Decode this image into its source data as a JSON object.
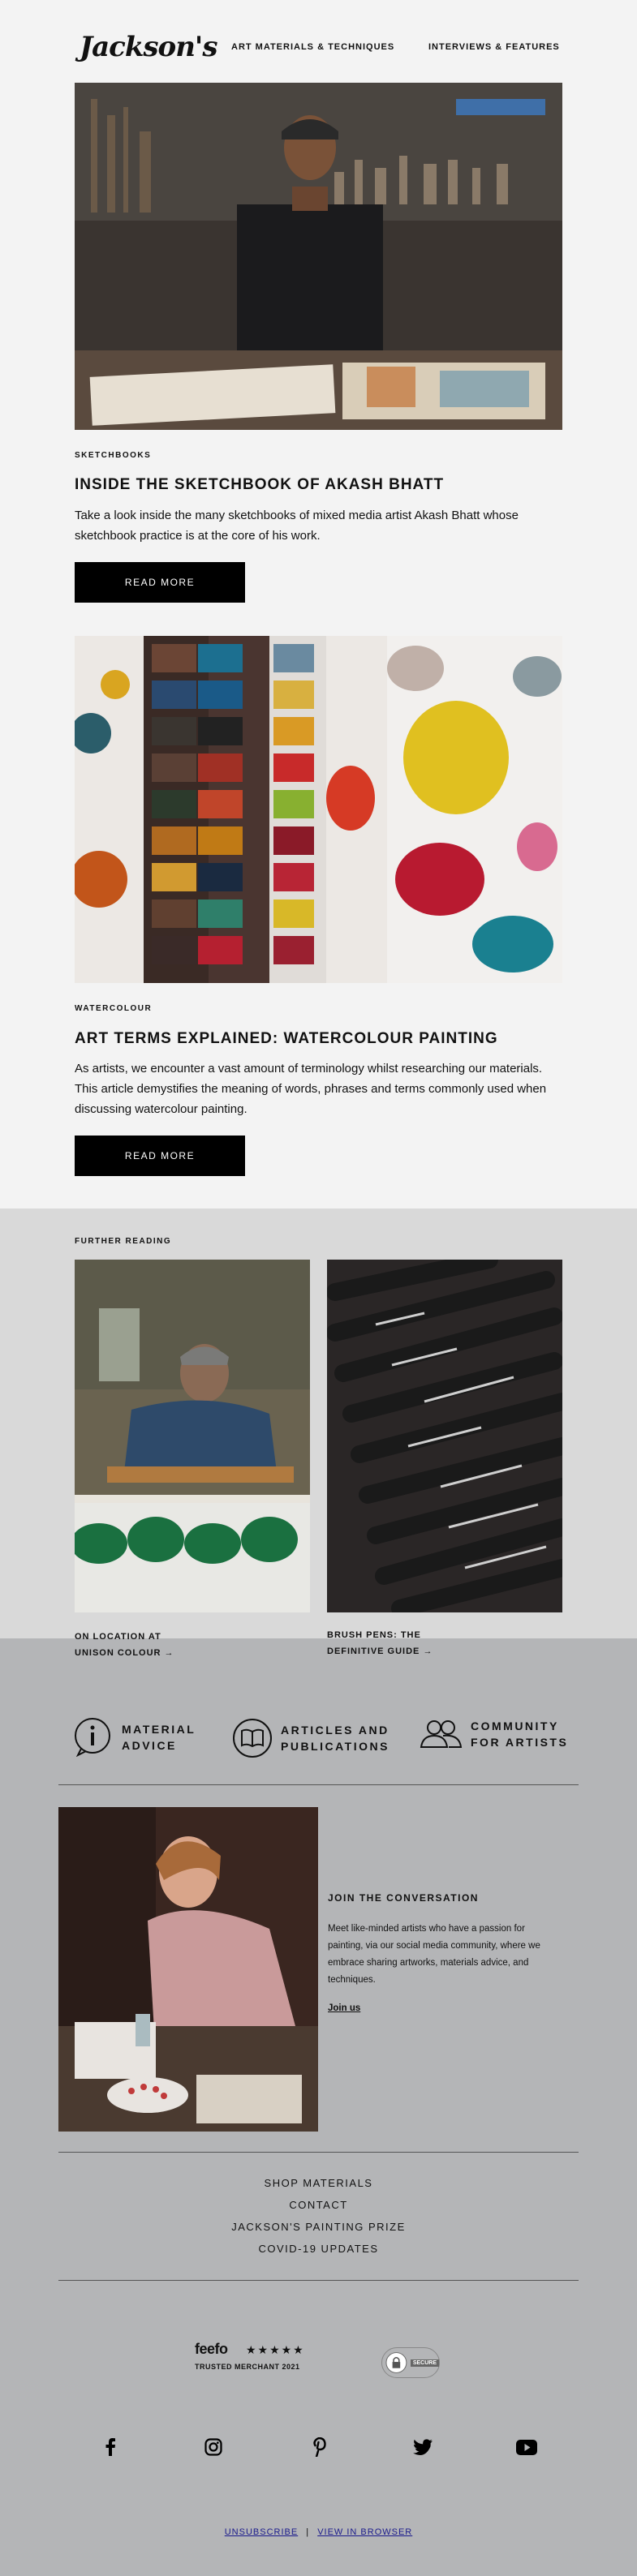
{
  "header": {
    "logo": "Jackson's",
    "nav": [
      "ART MATERIALS & TECHNIQUES",
      "INTERVIEWS & FEATURES"
    ]
  },
  "articles": [
    {
      "tag": "SKETCHBOOKS",
      "title": "INSIDE THE SKETCHBOOK OF AKASH BHATT",
      "body": "Take a look inside the many sketchbooks of mixed media artist Akash Bhatt whose sketchbook practice is at the core of his work.",
      "cta": "READ MORE"
    },
    {
      "tag": "WATERCOLOUR",
      "title": "ART TERMS EXPLAINED: WATERCOLOUR PAINTING",
      "body": "As artists, we encounter a vast amount of terminology whilst researching our materials. This article demystifies the meaning of words, phrases and terms commonly used when discussing watercolour painting.",
      "cta": "READ MORE"
    }
  ],
  "further": {
    "heading": "FURTHER READING",
    "items": [
      {
        "line1": "ON LOCATION AT",
        "line2": "UNISON COLOUR →"
      },
      {
        "line1": "BRUSH PENS: THE",
        "line2": "DEFINITIVE GUIDE →"
      }
    ]
  },
  "features": [
    {
      "icon": "info-icon",
      "line1": "MATERIAL",
      "line2": "ADVICE"
    },
    {
      "icon": "book-icon",
      "line1": "ARTICLES AND",
      "line2": "PUBLICATIONS"
    },
    {
      "icon": "people-icon",
      "line1": "COMMUNITY",
      "line2": "FOR ARTISTS"
    }
  ],
  "community": {
    "heading": "JOIN THE CONVERSATION",
    "body": "Meet like-minded artists who have a passion for painting, via our social media community, where we embrace sharing artworks, materials advice, and techniques.",
    "link": "Join us"
  },
  "footer_links": [
    "SHOP MATERIALS",
    "CONTACT",
    "JACKSON'S PAINTING PRIZE",
    "COVID-19 UPDATES"
  ],
  "badges": {
    "feefo": "feefo",
    "stars": "★★★★★",
    "trusted": "TRUSTED MERCHANT 2021",
    "secure": "SECURE"
  },
  "social": [
    "facebook-icon",
    "instagram-icon",
    "pinterest-icon",
    "twitter-icon",
    "youtube-icon"
  ],
  "bottom": {
    "unsubscribe": "UNSUBSCRIBE",
    "sep": "|",
    "view": "VIEW IN BROWSER"
  },
  "colors": {
    "dark": "#000000",
    "section_light": "#f3f3f3",
    "section_mid": "#d9d9d9",
    "section_grey": "#b4b5b7",
    "link_blue": "#1a1a8c"
  }
}
